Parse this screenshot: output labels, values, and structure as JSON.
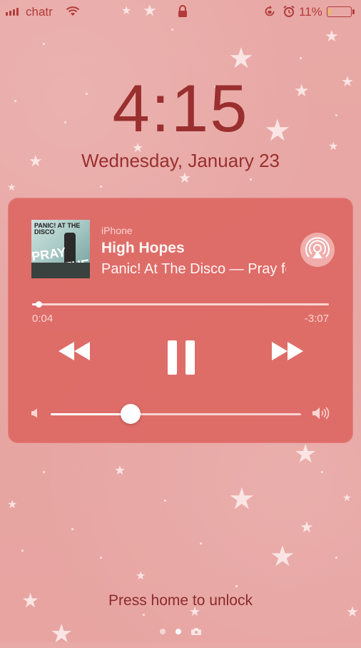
{
  "status_bar": {
    "carrier": "chatr",
    "battery_percent_label": "11%",
    "battery_level": 0.11,
    "signal_bars": 4
  },
  "lock_screen": {
    "time": "4:15",
    "date": "Wednesday, January 23",
    "unlock_hint": "Press home to unlock",
    "page_indicator": {
      "count": 2,
      "active_index": 1,
      "has_camera": true
    }
  },
  "now_playing": {
    "source": "iPhone",
    "title": "High Hopes",
    "artist_album": "Panic! At The Disco — Pray for the Wicked",
    "album_art_text": [
      "PANIC! AT THE DISCO",
      "PRAY FOR THE WICKED"
    ],
    "elapsed": "0:04",
    "remaining": "-3:07",
    "progress_fraction": 0.021,
    "volume_fraction": 0.32,
    "is_playing": true
  },
  "colors": {
    "background": "#e9a9a6",
    "panel": "#dc5f5a",
    "text_dark": "#9a2f2f",
    "status": "#b23b3b",
    "battery_fill": "#e7c24e"
  },
  "icons": [
    "signal-icon",
    "wifi-icon",
    "lock-icon",
    "rotation-lock-icon",
    "alarm-icon",
    "battery-icon",
    "airplay-icon",
    "rewind-icon",
    "pause-icon",
    "fast-forward-icon",
    "volume-low-icon",
    "volume-high-icon",
    "camera-icon"
  ]
}
